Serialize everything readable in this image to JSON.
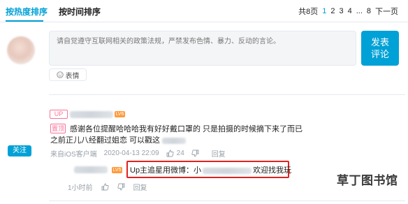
{
  "tabs": [
    {
      "label": "按热度排序",
      "active": true
    },
    {
      "label": "按时间排序",
      "active": false
    }
  ],
  "pager": {
    "total": "共8页",
    "pages": [
      "1",
      "2",
      "3",
      "4"
    ],
    "ellipsis": "...",
    "last": "8",
    "next": "下一页",
    "current": "1"
  },
  "composer": {
    "placeholder": "请自觉遵守互联网相关的政策法规，严禁发布色情、暴力、反动的言论。",
    "submit_line1": "发表",
    "submit_line2": "评论",
    "emoji_label": "表情"
  },
  "comment": {
    "up_badge": "UP",
    "level_badge": "LV6",
    "top_badge": "置顶",
    "text_line1": "感谢各位提醒哈哈哈我有好好戴口罩的 只是拍摄的时候摘下来了而已",
    "text_line2": "之前正儿八经翻过姐恋 可以戳这",
    "source": "来自iOS客户端",
    "timestamp": "2020-04-13 22:09",
    "likes": "24",
    "reply_label": "回复",
    "follow_label": "关注"
  },
  "reply": {
    "level_badge": "LV5",
    "text_prefix": "Up主追星用微博：小",
    "text_suffix": "欢迎找我玩",
    "time": "1小时前",
    "reply_label": "回复"
  },
  "watermark": "草丁图书馆",
  "colors": {
    "accent": "#00a1d6",
    "pink": "#fb7299",
    "highlight": "#e0221e"
  }
}
